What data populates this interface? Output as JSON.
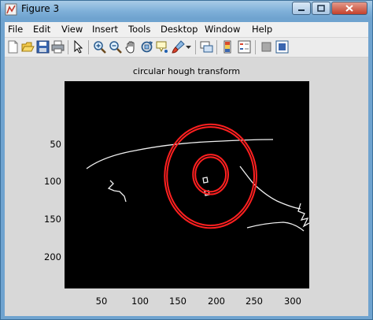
{
  "window": {
    "title": "Figure 3"
  },
  "menu": [
    "File",
    "Edit",
    "View",
    "Insert",
    "Tools",
    "Desktop",
    "Window",
    "Help"
  ],
  "toolbar": [
    "new-figure-icon",
    "open-file-icon",
    "save-icon",
    "print-icon",
    "edit-plot-arrow-icon",
    "zoom-in-icon",
    "zoom-out-icon",
    "pan-hand-icon",
    "rotate-3d-icon",
    "data-cursor-icon",
    "brush-icon",
    "brush-dropdown-icon",
    "link-plot-icon",
    "insert-colorbar-icon",
    "insert-legend-icon",
    "hide-plot-tools-icon",
    "show-plot-tools-icon"
  ],
  "chart_data": {
    "type": "image",
    "title": "circular hough transform",
    "x_ticks": [
      "50",
      "100",
      "150",
      "200",
      "250",
      "300"
    ],
    "y_ticks": [
      "50",
      "100",
      "150",
      "200"
    ],
    "xlim": [
      0,
      320
    ],
    "ylim": [
      240,
      0
    ],
    "background": "#000000",
    "circles": [
      {
        "center": [
          191,
          110
        ],
        "radius": 60,
        "color": "#ff2020"
      },
      {
        "center": [
          191,
          110
        ],
        "radius": 57,
        "color": "#ff2020"
      },
      {
        "center": [
          191,
          108
        ],
        "radius": 23,
        "color": "#ff2020"
      },
      {
        "center": [
          191,
          108
        ],
        "radius": 20,
        "color": "#ff2020"
      }
    ]
  }
}
